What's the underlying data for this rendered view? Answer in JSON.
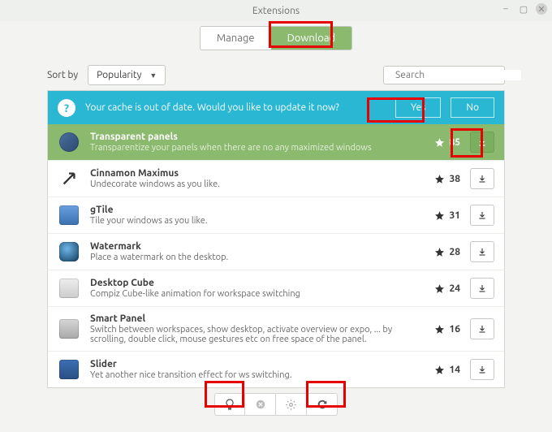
{
  "window": {
    "title": "Extensions"
  },
  "tabs": {
    "manage": "Manage",
    "download": "Download"
  },
  "sort": {
    "label": "Sort by",
    "value": "Popularity"
  },
  "search": {
    "placeholder": "Search"
  },
  "notice": {
    "message": "Your cache is out of date. Would you like to update it now?",
    "yes": "Yes",
    "no": "No"
  },
  "items": [
    {
      "name": "Transparent panels",
      "desc": "Transparentize your panels when there are no any maximized windows",
      "stars": 85
    },
    {
      "name": "Cinnamon Maximus",
      "desc": "Undecorate windows as you like.",
      "stars": 38
    },
    {
      "name": "gTile",
      "desc": "Tile your windows as you like.",
      "stars": 31
    },
    {
      "name": "Watermark",
      "desc": "Place a watermark on the desktop.",
      "stars": 28
    },
    {
      "name": "Desktop Cube",
      "desc": "Compiz Cube-like animation for workspace switching",
      "stars": 24
    },
    {
      "name": "Smart Panel",
      "desc": "Switch between workspaces, show desktop, activate overview or expo, ... by scrolling, double click, mouse gestures etc on free space of the panel.",
      "stars": 16
    },
    {
      "name": "Slider",
      "desc": "Yet another nice transition effect for ws switching.",
      "stars": 14
    }
  ]
}
